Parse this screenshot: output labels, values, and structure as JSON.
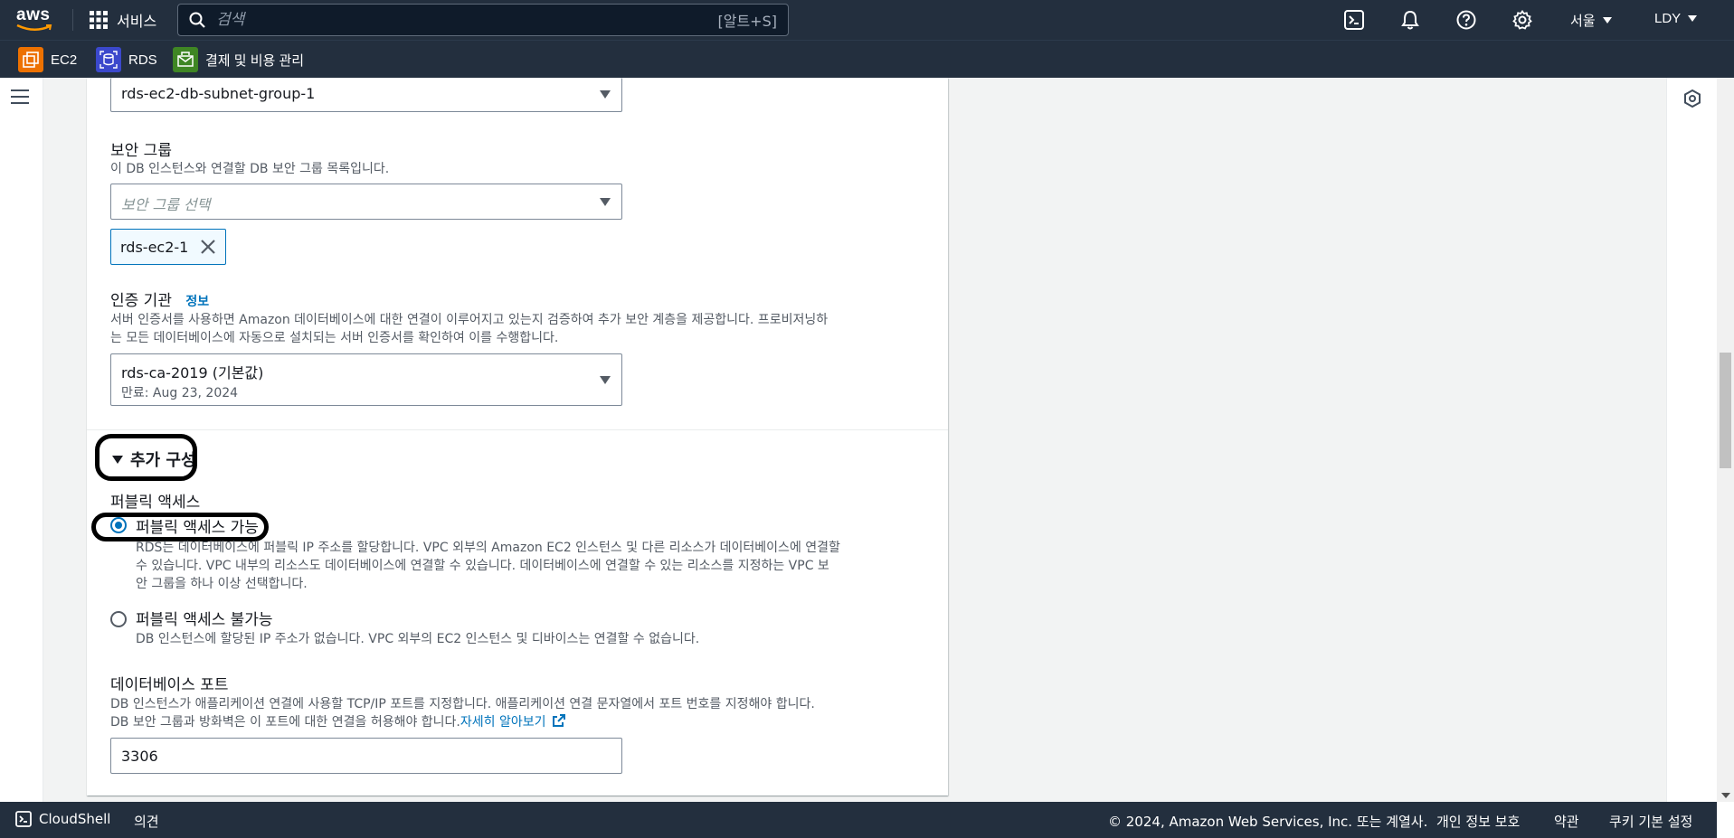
{
  "topnav": {
    "logo_text": "aws",
    "services_label": "서비스",
    "search_placeholder": "검색",
    "search_shortcut": "[알트+S]",
    "region": "서울",
    "user": "LDY"
  },
  "favorites": [
    {
      "label": "EC2",
      "color": "#ed7100"
    },
    {
      "label": "RDS",
      "color": "#3b48cc"
    },
    {
      "label": "결제 및 비용 관리",
      "color": "#3f8624"
    }
  ],
  "form": {
    "subnet_group_value": "rds-ec2-db-subnet-group-1",
    "security_group": {
      "label": "보안 그룹",
      "description": "이 DB 인스턴스와 연결할 DB 보안 그룹 목록입니다.",
      "placeholder": "보안 그룹 선택",
      "token": "rds-ec2-1"
    },
    "certificate_authority": {
      "label": "인증 기관",
      "info": "정보",
      "description_line1": "서버 인증서를 사용하면 Amazon 데이터베이스에 대한 연결이 이루어지고 있는지 검증하여 추가 보안 계층을 제공합니다. 프로비저닝하",
      "description_line2": "는 모든 데이터베이스에 자동으로 설치되는 서버 인증서를 확인하여 이를 수행합니다.",
      "value": "rds-ca-2019 (기본값)",
      "expiry": "만료: Aug 23, 2024"
    },
    "additional_config": {
      "label": "추가 구성"
    },
    "public_access": {
      "label": "퍼블릭 액세스",
      "option_yes_label": "퍼블릭 액세스 가능",
      "option_yes_desc_line1": "RDS는 데이터베이스에 퍼블릭 IP 주소를 할당합니다. VPC 외부의 Amazon EC2 인스턴스 및 다른 리소스가 데이터베이스에 연결할",
      "option_yes_desc_line2": "수 있습니다. VPC 내부의 리소스도 데이터베이스에 연결할 수 있습니다. 데이터베이스에 연결할 수 있는 리소스를 지정하는 VPC 보",
      "option_yes_desc_line3": "안 그룹을 하나 이상 선택합니다.",
      "option_no_label": "퍼블릭 액세스 불가능",
      "option_no_desc": "DB 인스턴스에 할당된 IP 주소가 없습니다. VPC 외부의 EC2 인스턴스 및 디바이스는 연결할 수 없습니다.",
      "selected": "yes"
    },
    "database_port": {
      "label": "데이터베이스 포트",
      "description_line1": "DB 인스턴스가 애플리케이션 연결에 사용할 TCP/IP 포트를 지정합니다. 애플리케이션 연결 문자열에서 포트 번호를 지정해야 합니다.",
      "description_line2": "DB 보안 그룹과 방화벽은 이 포트에 대한 연결을 허용해야 합니다.",
      "learn_more": "자세히 알아보기",
      "value": "3306"
    }
  },
  "footer": {
    "cloudshell": "CloudShell",
    "feedback": "의견",
    "copyright": "© 2024, Amazon Web Services, Inc. 또는 계열사.",
    "privacy": "개인 정보 보호",
    "terms": "약관",
    "cookies": "쿠키 기본 설정"
  }
}
